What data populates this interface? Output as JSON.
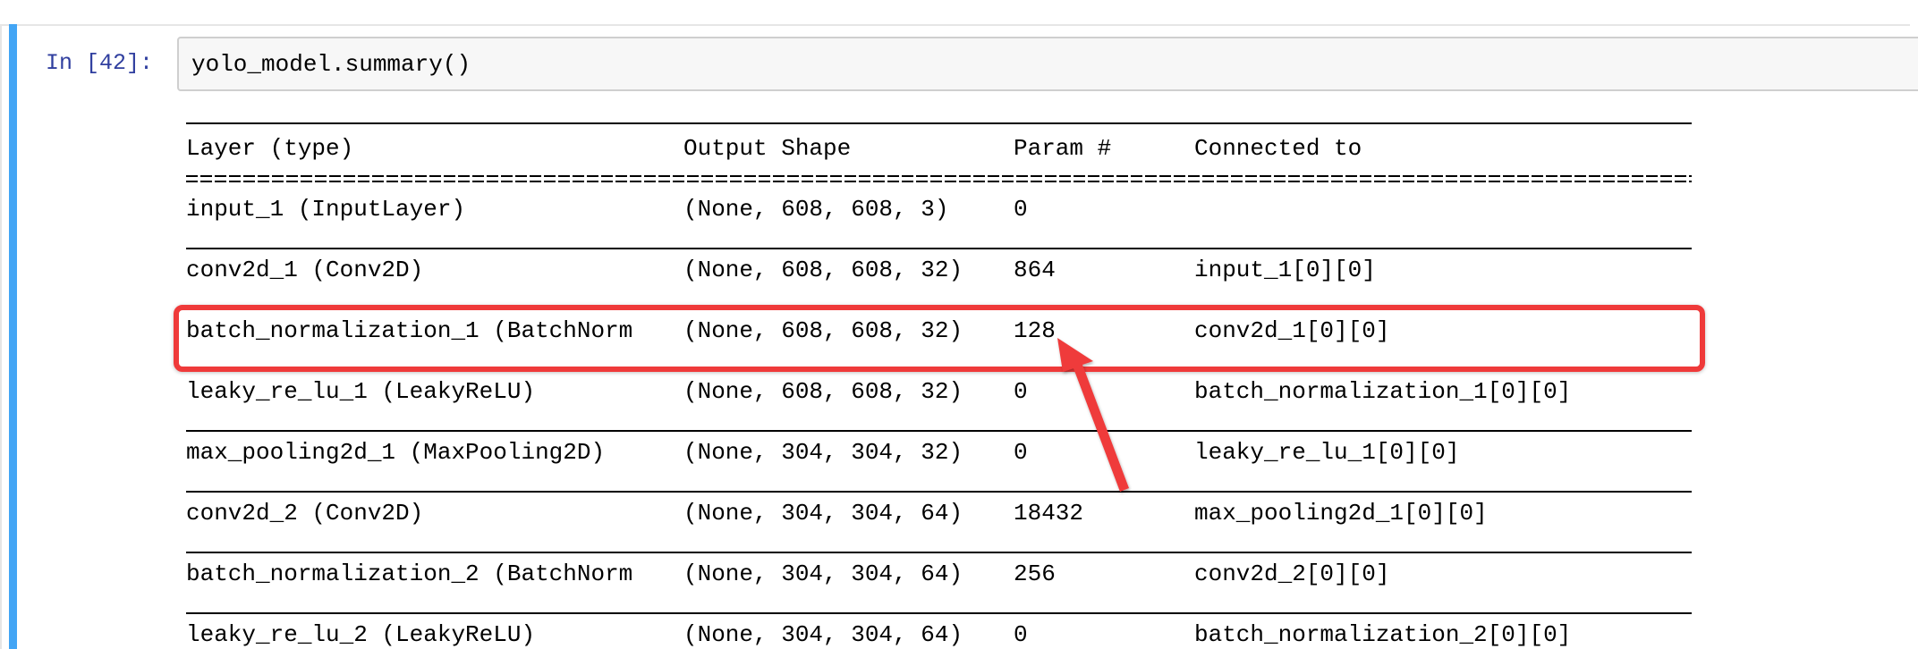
{
  "cell": {
    "prompt": "In [42]:",
    "code": "yolo_model.summary()"
  },
  "summary": {
    "headers": {
      "layer": "Layer (type)",
      "output_shape": "Output Shape",
      "params": "Param #",
      "connected": "Connected to"
    },
    "separator": "====================================================================================================",
    "rows": [
      {
        "layer": "input_1 (InputLayer)",
        "output_shape": "(None, 608, 608, 3)",
        "params": "0",
        "connected": ""
      },
      {
        "layer": "conv2d_1 (Conv2D)",
        "output_shape": "(None, 608, 608, 32)",
        "params": "864",
        "connected": "input_1[0][0]"
      },
      {
        "layer": "batch_normalization_1 (BatchNorm",
        "output_shape": "(None, 608, 608, 32)",
        "params": "128",
        "connected": "conv2d_1[0][0]"
      },
      {
        "layer": "leaky_re_lu_1 (LeakyReLU)",
        "output_shape": "(None, 608, 608, 32)",
        "params": "0",
        "connected": "batch_normalization_1[0][0]"
      },
      {
        "layer": "max_pooling2d_1 (MaxPooling2D)",
        "output_shape": "(None, 304, 304, 32)",
        "params": "0",
        "connected": "leaky_re_lu_1[0][0]"
      },
      {
        "layer": "conv2d_2 (Conv2D)",
        "output_shape": "(None, 304, 304, 64)",
        "params": "18432",
        "connected": "max_pooling2d_1[0][0]"
      },
      {
        "layer": "batch_normalization_2 (BatchNorm",
        "output_shape": "(None, 304, 304, 64)",
        "params": "256",
        "connected": "conv2d_2[0][0]"
      },
      {
        "layer": "leaky_re_lu_2 (LeakyReLU)",
        "output_shape": "(None, 304, 304, 64)",
        "params": "0",
        "connected": "batch_normalization_2[0][0]"
      }
    ]
  },
  "annotation": {
    "highlighted_row": "batch_normalization_1 (BatchNorm",
    "highlight_color": "#ef3a3a",
    "arrow_icon": "red-arrow-icon"
  },
  "colors": {
    "prompt": "#303f9f",
    "selected_bar": "#42a5f5"
  }
}
